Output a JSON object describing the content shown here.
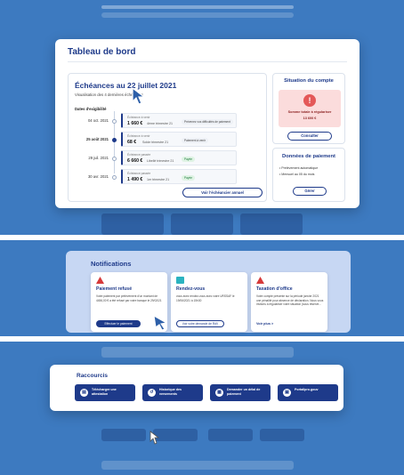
{
  "dashboard": {
    "title": "Tableau de bord",
    "echeances": {
      "title": "Échéances au 22 juillet 2021",
      "subtitle": "Visualisation des 4 dernières échéances",
      "dates_label": "Dates d'exigibilité",
      "rows": [
        {
          "date": "04 oct. 2021",
          "kind": "Échéance à venir",
          "amount": "1 660 €",
          "label": "4ème trimestre 21",
          "badge": "Prévenez vos difficultés de paiement",
          "active": false,
          "status": "neutral"
        },
        {
          "date": "25 août 2021",
          "kind": "Échéance à venir",
          "amount": "68 €",
          "label": "Solde trimestre 21",
          "badge": "Paiement à venir",
          "active": true,
          "status": "neutral"
        },
        {
          "date": "29 juil. 2021",
          "kind": "Échéance passée",
          "amount": "6 660 €",
          "label": "Libellé trimestre 21",
          "badge": "Payée",
          "active": false,
          "status": "ok"
        },
        {
          "date": "30 avr. 2021",
          "kind": "Échéance passée",
          "amount": "1 490 €",
          "label": "1er trimestre 21",
          "badge": "Payée",
          "active": false,
          "status": "ok"
        }
      ],
      "button": "Voir l'échéancier annuel"
    },
    "situation": {
      "title": "Situation du compte",
      "alert_label": "Somme totale à régulariser",
      "alert_amount": "13 600 €",
      "button": "Consulter"
    },
    "donnees": {
      "title": "Données de paiement",
      "items": [
        "Prélèvement automatique",
        "Mensuel au 05 du mois"
      ],
      "button": "Gérer"
    }
  },
  "notifications": {
    "title": "Notifications",
    "cards": [
      {
        "title": "Paiement refusé",
        "text": "Votre paiement par prélèvement d'un montant de 4456,00 € a été refusé par votre banque le 29/02/21",
        "action": "Effectuer le paiement"
      },
      {
        "title": "Rendez-vous",
        "text": "vous avez rendez-vous avec votre URSSAF le 19/06/2021 à 15h30",
        "action": "Voir votre demande de RdV"
      },
      {
        "title": "Taxation d'office",
        "text": "Votre compte présente sur la période janvier 2021 une pénalité pour absence de déclaration. Nous vous invitons à régulariser votre situation (sous réserve...",
        "action": "Voir plus  >"
      }
    ]
  },
  "raccourcis": {
    "title": "Raccourcis",
    "items": [
      {
        "label": "Télécharger une attestation",
        "icon": "document-icon"
      },
      {
        "label": "Historique des versements",
        "icon": "history-icon"
      },
      {
        "label": "Demander un délai de paiement",
        "icon": "calendar-icon"
      },
      {
        "label": "Portailpro.gouv",
        "icon": "portal-icon"
      }
    ]
  },
  "colors": {
    "background_blue": "#3d7ac0",
    "primary": "#1e3a8a",
    "alert_red": "#e45858",
    "alert_bg": "#fbdcdc",
    "success": "#1c7a3a"
  }
}
